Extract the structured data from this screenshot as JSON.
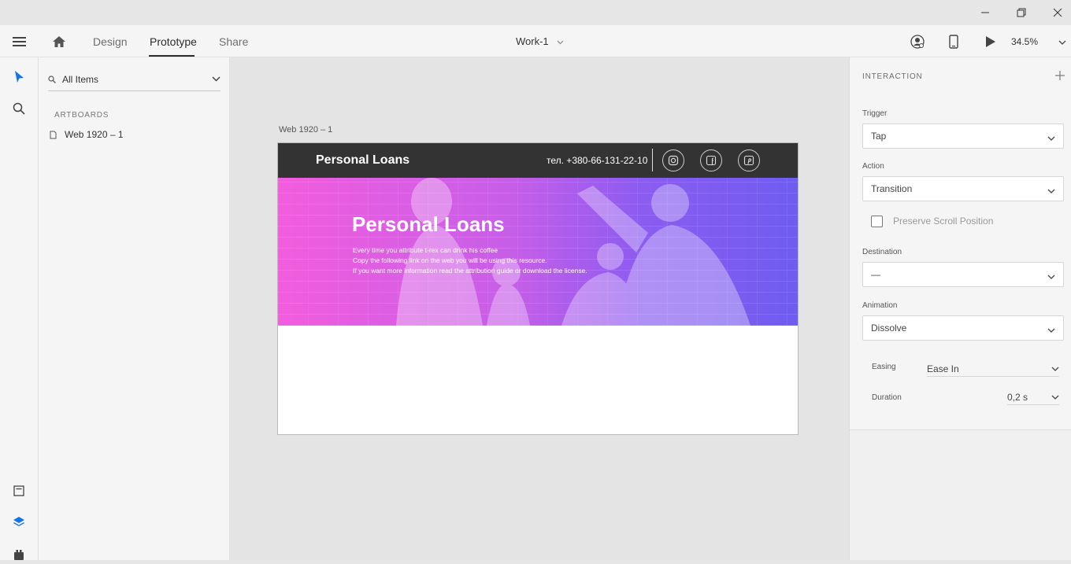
{
  "window": {
    "minimize_icon": "minimize-icon",
    "maximize_icon": "restore-icon",
    "close_icon": "close-icon"
  },
  "toolbar": {
    "menu_icon": "hamburger-icon",
    "home_icon": "home-icon",
    "tabs": [
      {
        "label": "Design"
      },
      {
        "label": "Prototype"
      },
      {
        "label": "Share"
      }
    ],
    "active_tab": "Prototype",
    "document_title": "Work-1",
    "zoom": "34.5%"
  },
  "left_rail": {
    "icons": [
      "select-arrow-icon",
      "search-icon",
      "assets-icon",
      "layers-icon",
      "plugins-icon"
    ]
  },
  "layers_panel": {
    "search_placeholder": "All Items",
    "section_header": "ARTBOARDS",
    "items": [
      {
        "label": "Web 1920 – 1"
      }
    ]
  },
  "canvas": {
    "artboard_label": "Web 1920 – 1",
    "artboard": {
      "logo": "Personal Loans",
      "phone": "тел. +380-66-131-22-10",
      "hero_title": "Personal Loans",
      "hero_lines": [
        "Every time you attribute t-rex can drink his coffee",
        "Copy the following link on the web you will be using this resource.",
        "If you want more information read the attribution guide or download the license."
      ]
    }
  },
  "interaction": {
    "header": "INTERACTION",
    "trigger_label": "Trigger",
    "trigger_value": "Tap",
    "action_label": "Action",
    "action_value": "Transition",
    "preserve_scroll_label": "Preserve Scroll Position",
    "destination_label": "Destination",
    "destination_value": "—",
    "animation_label": "Animation",
    "animation_value": "Dissolve",
    "easing_label": "Easing",
    "easing_value": "Ease In",
    "duration_label": "Duration",
    "duration_value": "0,2 s"
  }
}
